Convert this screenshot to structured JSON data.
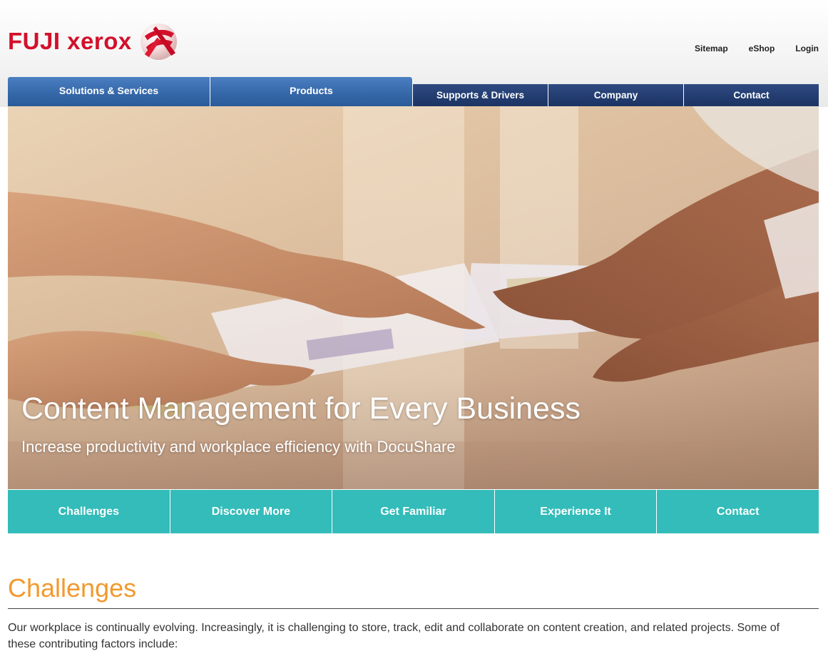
{
  "brand": {
    "logo_text": "FUJI xerox",
    "color": "#d3102a"
  },
  "utility_nav": [
    "Sitemap",
    "eShop",
    "Login"
  ],
  "main_nav": {
    "items": [
      "Solutions & Services",
      "Products",
      "Supports & Drivers",
      "Company",
      "Contact"
    ],
    "active_color": "#3467a8",
    "inactive_color": "#223c6f"
  },
  "hero": {
    "title": "Content Management for Every Business",
    "subtitle": "Increase productivity and workplace efficiency with DocuShare"
  },
  "sub_nav": {
    "items": [
      "Challenges",
      "Discover More",
      "Get Familiar",
      "Experience It",
      "Contact"
    ],
    "color": "#33bcb9"
  },
  "section": {
    "title": "Challenges",
    "title_color": "#f2992e",
    "intro": "Our workplace is continually evolving. Increasingly, it is challenging to store, track, edit and collaborate on content creation, and related projects. Some of these contributing factors include:"
  }
}
